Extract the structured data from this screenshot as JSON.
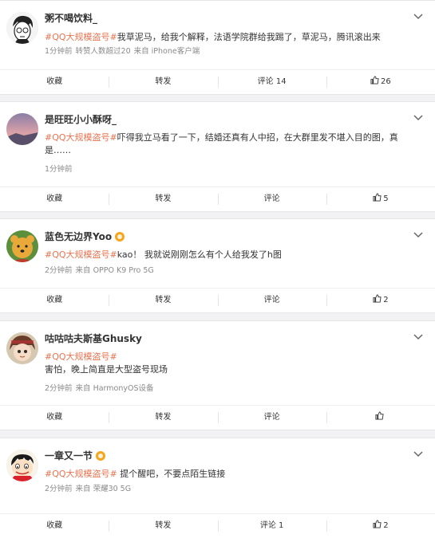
{
  "posts": [
    {
      "username": "粥不喝饮料_",
      "verified": false,
      "hashtag": "#QQ大规模盗号#",
      "text_lines": [
        "我草泥马，给我个解释，法语学院群给我踢了，草泥马，腾讯滚出来"
      ],
      "meta": [
        "1分钟前",
        "转赞人数超过20",
        "来自 iPhone客户端"
      ],
      "actions": {
        "favorite": "收藏",
        "repost": "转发",
        "comment": "评论 14",
        "like": "26"
      }
    },
    {
      "username": "是旺旺小小酥呀_",
      "verified": false,
      "hashtag": "#QQ大规模盗号#",
      "text_lines": [
        "吓得我立马看了一下，结婚还真有人中招，在大群里发不堪入目的图，真",
        "是……"
      ],
      "meta": [
        "1分钟前"
      ],
      "actions": {
        "favorite": "收藏",
        "repost": "转发",
        "comment": "评论",
        "like": "5"
      }
    },
    {
      "username": "蓝色无边界Yoo",
      "verified": true,
      "hashtag": "#QQ大规模盗号#",
      "text_lines": [
        "kao！ 我就说刚刚怎么有个人给我发了h图"
      ],
      "meta": [
        "2分钟前",
        "来自 OPPO K9 Pro 5G"
      ],
      "actions": {
        "favorite": "收藏",
        "repost": "转发",
        "comment": "评论",
        "like": "2"
      }
    },
    {
      "username": "咕咕咕夫斯基Ghusky",
      "verified": false,
      "hashtag": "#QQ大规模盗号#",
      "text_lines": [
        "",
        "害怕，晚上简直是大型盗号现场"
      ],
      "meta": [
        "2分钟前",
        "来自 HarmonyOS设备"
      ],
      "actions": {
        "favorite": "收藏",
        "repost": "转发",
        "comment": "评论",
        "like": ""
      }
    },
    {
      "username": "一章又一节",
      "verified": true,
      "hashtag": "#QQ大规模盗号#",
      "text_lines": [
        " 提个醒吧，不要点陌生链接"
      ],
      "meta": [
        "2分钟前",
        "来自 荣耀30 5G"
      ],
      "actions": {
        "favorite": "收藏",
        "repost": "转发",
        "comment": "评论 1",
        "like": "2"
      }
    }
  ],
  "colors": {
    "hashtag": "#eb7350",
    "badge": "#f7a51c",
    "background": "#f2f2f5"
  }
}
